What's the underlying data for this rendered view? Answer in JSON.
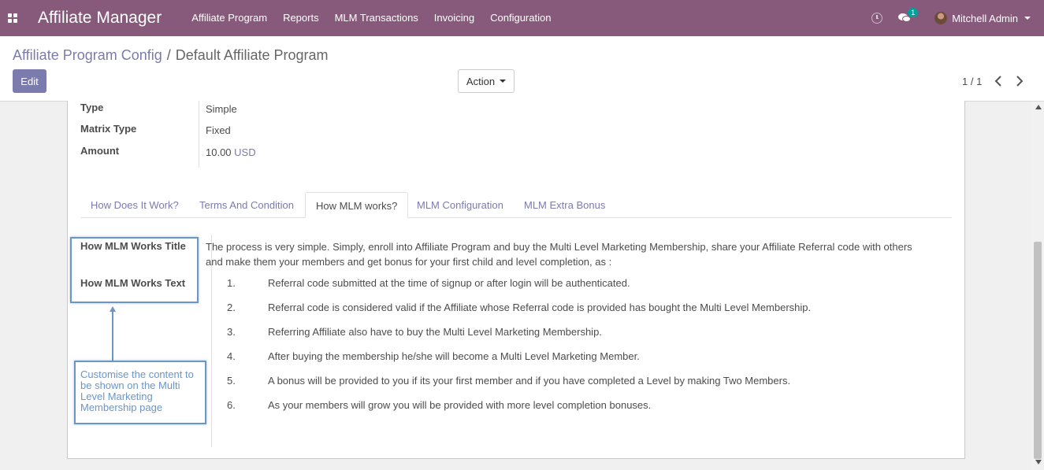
{
  "navbar": {
    "app_title": "Affiliate Manager",
    "menu": [
      "Affiliate Program",
      "Reports",
      "MLM Transactions",
      "Invoicing",
      "Configuration"
    ],
    "chat_badge": "1",
    "user_name": "Mitchell Admin"
  },
  "control_panel": {
    "breadcrumb_parent": "Affiliate Program Config",
    "breadcrumb_separator": "/",
    "breadcrumb_current": "Default Affiliate Program",
    "edit_label": "Edit",
    "action_label": "Action",
    "pager": "1 / 1"
  },
  "fields": {
    "type_label": "Type",
    "type_value": "Simple",
    "matrix_type_label": "Matrix Type",
    "matrix_type_value": "Fixed",
    "amount_label": "Amount",
    "amount_value": "10.00",
    "amount_currency": "USD"
  },
  "tabs": [
    "How Does It Work?",
    "Terms And Condition",
    "How MLM works?",
    "MLM Configuration",
    "MLM Extra Bonus"
  ],
  "active_tab": "How MLM works?",
  "tab_content": {
    "title_label": "How MLM Works Title",
    "text_label": "How MLM Works Text",
    "intro": "The process is very simple. Simply, enroll into Affiliate Program and buy the Multi Level Marketing Membership, share your Affiliate Referral code with others and make them your members and get bonus for your first child and level completion, as :",
    "steps": [
      {
        "num": "1.",
        "text": "Referral code submitted at the time of signup or after login will be authenticated."
      },
      {
        "num": "2.",
        "text": "Referral code is considered valid if the Affiliate whose Referral code is provided has bought the Multi Level Membership."
      },
      {
        "num": "3.",
        "text": "Referring Affiliate also have to buy the Multi Level Marketing Membership."
      },
      {
        "num": "4.",
        "text": "After buying the membership he/she will become a Multi Level Marketing Member."
      },
      {
        "num": "5.",
        "text": "A bonus will be provided to you if its your first member and if you have completed a Level by making Two Members."
      },
      {
        "num": "6.",
        "text": "As your members will grow you will be provided with more level completion bonuses."
      }
    ]
  },
  "annotation": {
    "text": "Customise the content to be shown on the Multi Level Marketing Membership page",
    "color": "#6a96c8"
  },
  "colors": {
    "navbar": "#875a7b",
    "primary": "#7c7bad",
    "badge": "#00a09d"
  }
}
